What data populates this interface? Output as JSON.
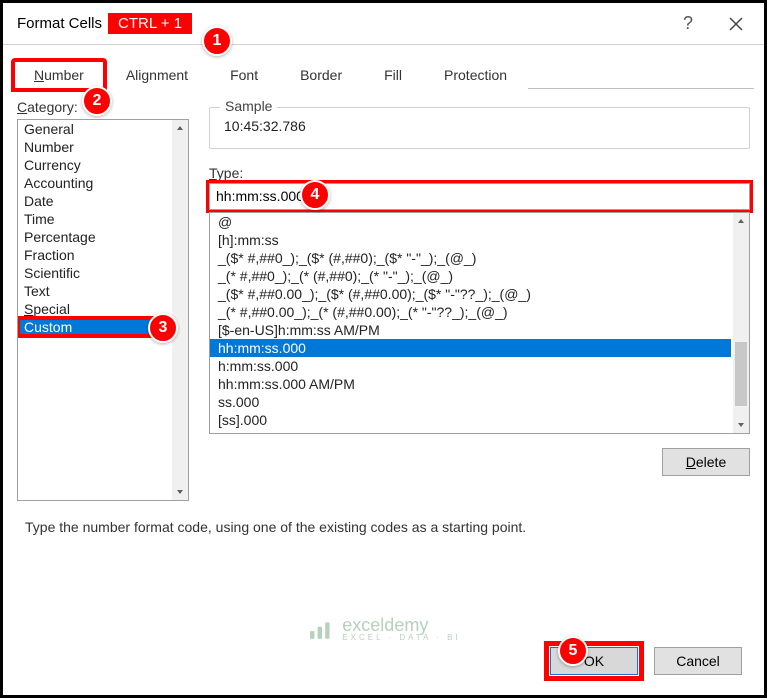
{
  "titlebar": {
    "title": "Format Cells",
    "shortcut": "CTRL + 1"
  },
  "tabs": [
    "Number",
    "Alignment",
    "Font",
    "Border",
    "Fill",
    "Protection"
  ],
  "activeTab": "Number",
  "category": {
    "label": "Category:",
    "items": [
      "General",
      "Number",
      "Currency",
      "Accounting",
      "Date",
      "Time",
      "Percentage",
      "Fraction",
      "Scientific",
      "Text",
      "Special",
      "Custom"
    ],
    "selected": "Custom"
  },
  "sample": {
    "label": "Sample",
    "value": "10:45:32.786"
  },
  "type": {
    "label": "Type:",
    "value": "hh:mm:ss.000",
    "items": [
      "@",
      "[h]:mm:ss",
      "_($* #,##0_);_($* (#,##0);_($* \"-\"_);_(@_)",
      "_(* #,##0_);_(* (#,##0);_(* \"-\"_);_(@_)",
      "_($* #,##0.00_);_($* (#,##0.00);_($* \"-\"??_);_(@_)",
      "_(* #,##0.00_);_(* (#,##0.00);_(* \"-\"??_);_(@_)",
      "[$-en-US]h:mm:ss AM/PM",
      "hh:mm:ss.000",
      "h:mm:ss.000",
      "hh:mm:ss.000 AM/PM",
      "ss.000",
      "[ss].000"
    ],
    "selected": "hh:mm:ss.000"
  },
  "buttons": {
    "delete": "Delete",
    "ok": "OK",
    "cancel": "Cancel"
  },
  "hint": "Type the number format code, using one of the existing codes as a starting point.",
  "callouts": [
    "1",
    "2",
    "3",
    "4",
    "5"
  ],
  "watermark": {
    "main": "exceldemy",
    "sub": "EXCEL · DATA · BI"
  }
}
